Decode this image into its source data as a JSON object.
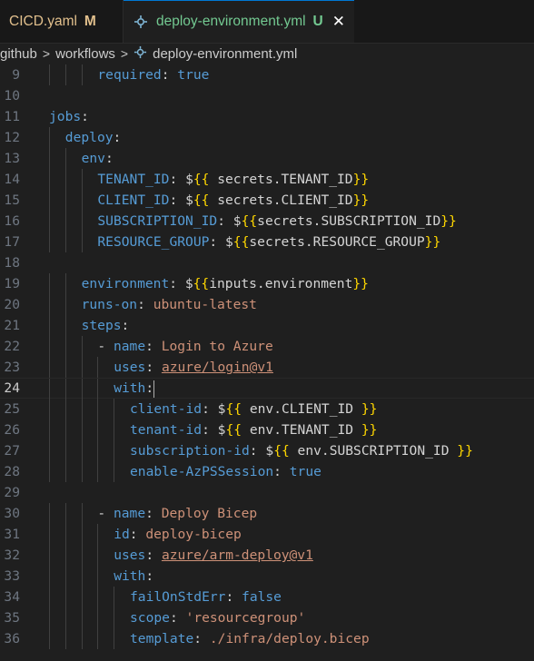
{
  "tabs": [
    {
      "name": "CICD.yaml",
      "status": "M",
      "active": false
    },
    {
      "name": "deploy-environment.yml",
      "status": "U",
      "active": true,
      "close": "✕"
    }
  ],
  "breadcrumb": {
    "parts": [
      "github",
      "workflows",
      "deploy-environment.yml"
    ],
    "sep": ">"
  },
  "editor": {
    "current_line": 24,
    "lines": [
      {
        "n": "9",
        "t": "required: true"
      },
      {
        "n": "10",
        "t": ""
      },
      {
        "n": "11",
        "t": "jobs:"
      },
      {
        "n": "12",
        "t": "deploy:"
      },
      {
        "n": "13",
        "t": "env:"
      },
      {
        "n": "14",
        "t": "TENANT_ID: ${{ secrets.TENANT_ID}}"
      },
      {
        "n": "15",
        "t": "CLIENT_ID: ${{ secrets.CLIENT_ID}}"
      },
      {
        "n": "16",
        "t": "SUBSCRIPTION_ID: ${{secrets.SUBSCRIPTION_ID}}"
      },
      {
        "n": "17",
        "t": "RESOURCE_GROUP: ${{secrets.RESOURCE_GROUP}}"
      },
      {
        "n": "18",
        "t": ""
      },
      {
        "n": "19",
        "t": "environment: ${{inputs.environment}}"
      },
      {
        "n": "20",
        "t": "runs-on: ubuntu-latest"
      },
      {
        "n": "21",
        "t": "steps:"
      },
      {
        "n": "22",
        "t": "- name: Login to Azure"
      },
      {
        "n": "23",
        "t": "uses: azure/login@v1"
      },
      {
        "n": "24",
        "t": "with:"
      },
      {
        "n": "25",
        "t": "client-id: ${{ env.CLIENT_ID }}"
      },
      {
        "n": "26",
        "t": "tenant-id: ${{ env.TENANT_ID }}"
      },
      {
        "n": "27",
        "t": "subscription-id: ${{ env.SUBSCRIPTION_ID }}"
      },
      {
        "n": "28",
        "t": "enable-AzPSSession: true"
      },
      {
        "n": "29",
        "t": ""
      },
      {
        "n": "30",
        "t": "- name: Deploy Bicep"
      },
      {
        "n": "31",
        "t": "id: deploy-bicep"
      },
      {
        "n": "32",
        "t": "uses: azure/arm-deploy@v1"
      },
      {
        "n": "33",
        "t": "with:"
      },
      {
        "n": "34",
        "t": "failOnStdErr: false"
      },
      {
        "n": "35",
        "t": "scope: 'resourcegroup'"
      },
      {
        "n": "36",
        "t": "template: ./infra/deploy.bicep"
      }
    ]
  },
  "colors": {
    "background": "#1f1f1f",
    "key": "#569cd6",
    "string": "#ce9178",
    "bracket": "#ffd700",
    "modified": "#e2c08d",
    "untracked": "#73c991",
    "accent": "#0078d4"
  },
  "icons": {
    "file_tab": "gear-icon",
    "breadcrumb_file": "gear-icon"
  }
}
